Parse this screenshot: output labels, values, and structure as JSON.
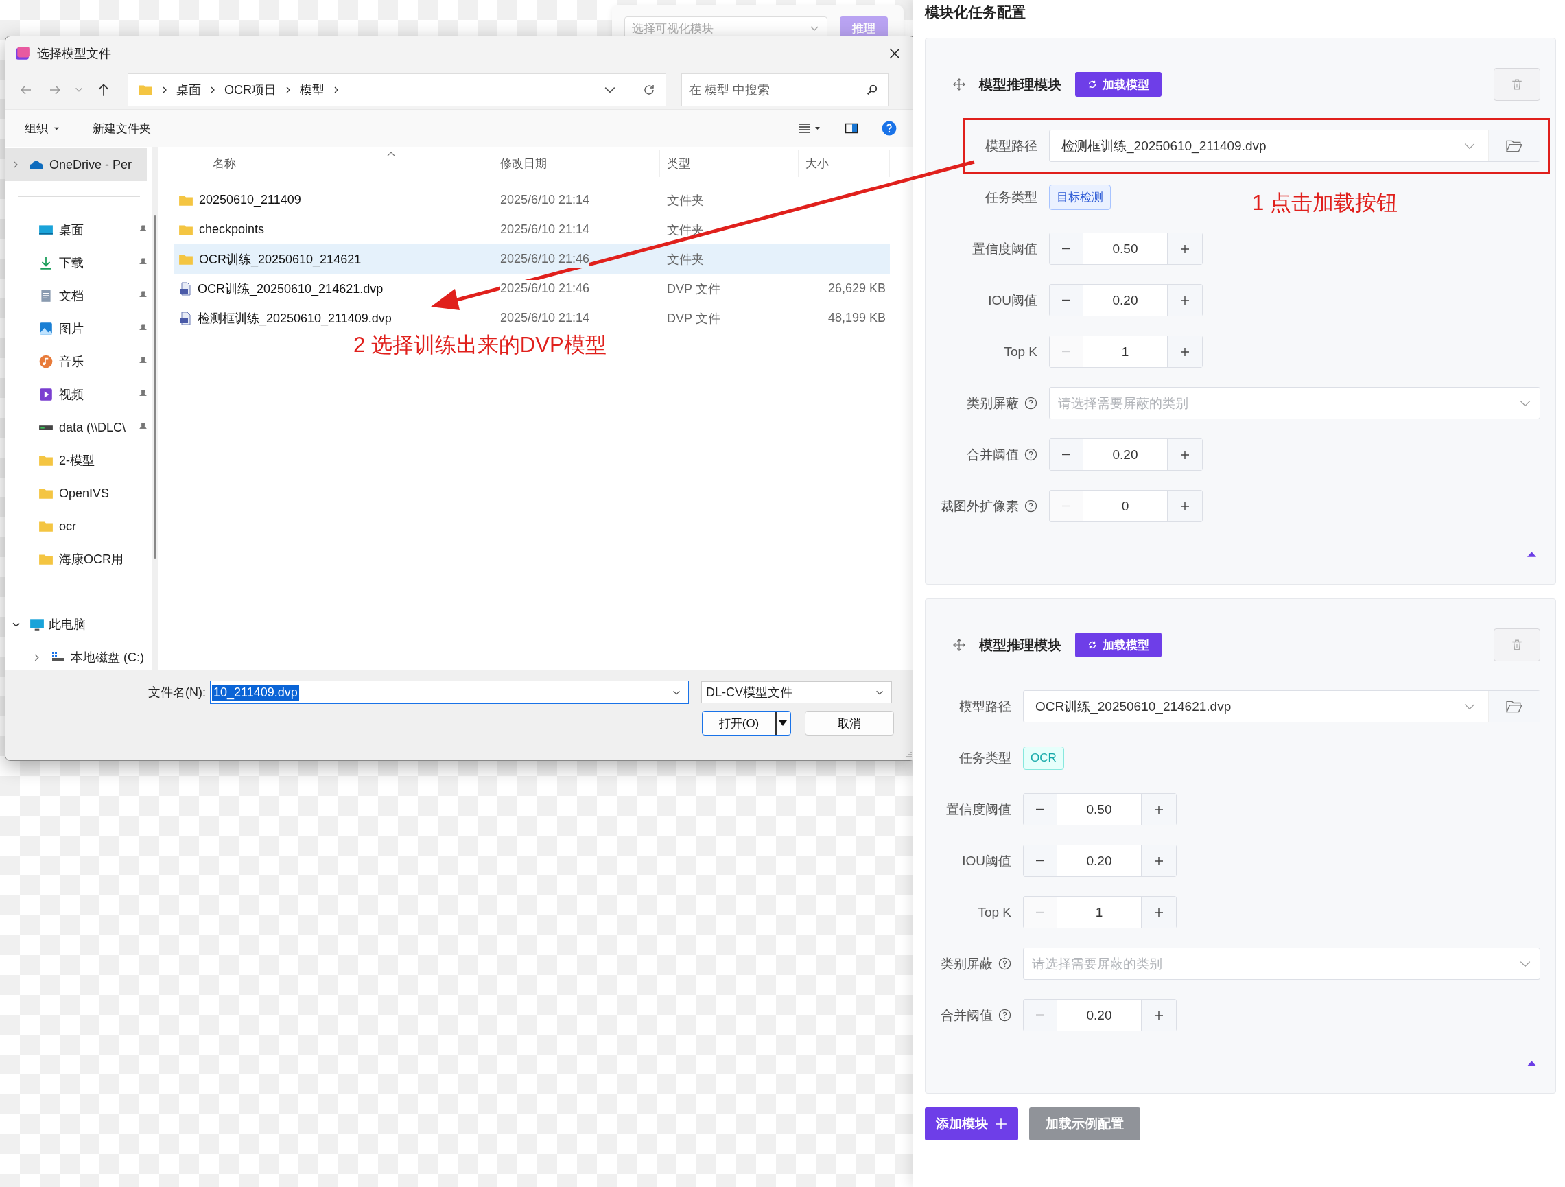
{
  "background_toolbar": {
    "select_placeholder": "选择可视化模块",
    "button": "推理"
  },
  "dialog": {
    "title": "选择模型文件",
    "breadcrumb": [
      "桌面",
      "OCR项目",
      "模型"
    ],
    "search_placeholder": "在 模型 中搜索",
    "organize": "组织",
    "new_folder": "新建文件夹",
    "sidebar_top": [
      {
        "label": "OneDrive - Per",
        "kind": "cloud",
        "expanded": false,
        "selected": true
      }
    ],
    "quick_access": [
      {
        "label": "桌面",
        "kind": "desktop",
        "pinned": true
      },
      {
        "label": "下载",
        "kind": "download",
        "pinned": true
      },
      {
        "label": "文档",
        "kind": "document",
        "pinned": true
      },
      {
        "label": "图片",
        "kind": "picture",
        "pinned": true
      },
      {
        "label": "音乐",
        "kind": "music",
        "pinned": true
      },
      {
        "label": "视频",
        "kind": "video",
        "pinned": true
      },
      {
        "label": "data (\\\\DLC\\",
        "kind": "drive",
        "pinned": true
      },
      {
        "label": "2-模型",
        "kind": "folder",
        "pinned": false
      },
      {
        "label": "OpenIVS",
        "kind": "folder",
        "pinned": false
      },
      {
        "label": "ocr",
        "kind": "folder",
        "pinned": false
      },
      {
        "label": "海康OCR用",
        "kind": "folder",
        "pinned": false
      }
    ],
    "tree": [
      {
        "label": "此电脑",
        "kind": "computer",
        "expanded": true,
        "children": [
          {
            "label": "本地磁盘 (C:)",
            "kind": "disk",
            "expanded": false
          }
        ]
      }
    ],
    "columns": [
      "名称",
      "修改日期",
      "类型",
      "大小"
    ],
    "files": [
      {
        "kind": "folder",
        "name": "20250610_211409",
        "date": "2025/6/10 21:14",
        "type": "文件夹",
        "selected": false
      },
      {
        "kind": "folder",
        "name": "checkpoints",
        "date": "2025/6/10 21:14",
        "type": "文件夹",
        "selected": false
      },
      {
        "kind": "folder",
        "name": "OCR训练_20250610_214621",
        "date": "2025/6/10 21:46",
        "type": "文件夹",
        "selected": true
      },
      {
        "kind": "dvp",
        "name": "OCR训练_20250610_214621.dvp",
        "date": "2025/6/10 21:46",
        "type": "DVP 文件",
        "size": "26,629 KB",
        "selected": false
      },
      {
        "kind": "dvp",
        "name": "检测框训练_20250610_211409.dvp",
        "date": "2025/6/10 21:14",
        "type": "DVP 文件",
        "size": "48,199 KB",
        "selected": false
      }
    ],
    "filename_label": "文件名(N):",
    "filename_value": "10_211409.dvp",
    "filetype": "DL-CV模型文件",
    "open_button": "打开(O)",
    "cancel_button": "取消"
  },
  "panel": {
    "title": "模块化任务配置",
    "modules": [
      {
        "title": "模型推理模块",
        "load_button": "加载模型",
        "path_label": "模型路径",
        "path": "检测框训练_20250610_211409.dvp",
        "highlighted": true,
        "task_label": "任务类型",
        "task_tag": {
          "label": "目标检测",
          "kind": "detection"
        },
        "expanded": true,
        "fields": [
          {
            "kind": "stepper",
            "label": "置信度阈值",
            "value": "0.50",
            "help": false,
            "minus_disabled": false
          },
          {
            "kind": "stepper",
            "label": "IOU阈值",
            "value": "0.20",
            "help": false,
            "minus_disabled": false
          },
          {
            "kind": "stepper",
            "label": "Top K",
            "value": "1",
            "help": false,
            "minus_disabled": true
          },
          {
            "kind": "select",
            "label": "类别屏蔽",
            "placeholder": "请选择需要屏蔽的类别",
            "help": true
          },
          {
            "kind": "stepper",
            "label": "合并阈值",
            "value": "0.20",
            "help": true,
            "minus_disabled": false
          },
          {
            "kind": "stepper",
            "label": "裁图外扩像素",
            "value": "0",
            "help": true,
            "minus_disabled": true
          }
        ]
      },
      {
        "title": "模型推理模块",
        "load_button": "加载模型",
        "path_label": "模型路径",
        "path": "OCR训练_20250610_214621.dvp",
        "highlighted": false,
        "task_label": "任务类型",
        "task_tag": {
          "label": "OCR",
          "kind": "ocr"
        },
        "expanded": true,
        "fields": [
          {
            "kind": "stepper",
            "label": "置信度阈值",
            "value": "0.50",
            "help": false,
            "minus_disabled": false
          },
          {
            "kind": "stepper",
            "label": "IOU阈值",
            "value": "0.20",
            "help": false,
            "minus_disabled": false
          },
          {
            "kind": "stepper",
            "label": "Top K",
            "value": "1",
            "help": false,
            "minus_disabled": true
          },
          {
            "kind": "select",
            "label": "类别屏蔽",
            "placeholder": "请选择需要屏蔽的类别",
            "help": true
          },
          {
            "kind": "stepper",
            "label": "合并阈值",
            "value": "0.20",
            "help": true,
            "minus_disabled": false
          }
        ]
      }
    ],
    "add_button": "添加模块",
    "load_example_button": "加载示例配置"
  },
  "annotations": [
    {
      "text": "1 点击加载按钮"
    },
    {
      "text": "2 选择训练出来的DVP模型"
    }
  ]
}
